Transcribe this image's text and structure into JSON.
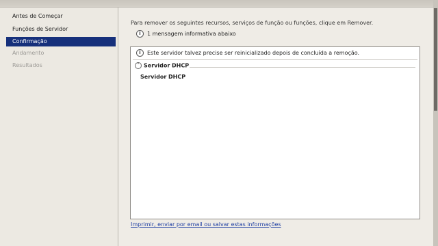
{
  "sidebar": {
    "items": [
      {
        "label": "Antes de Começar",
        "state": "normal"
      },
      {
        "label": "Funções de Servidor",
        "state": "normal"
      },
      {
        "label": "Confirmação",
        "state": "active"
      },
      {
        "label": "Andamento",
        "state": "disabled"
      },
      {
        "label": "Resultados",
        "state": "disabled"
      }
    ]
  },
  "main": {
    "instruction": "Para remover os seguintes recursos, serviços de função ou funções, clique em Remover.",
    "message_bar": "1 mensagem informativa abaixo",
    "info_icon_glyph": "i",
    "content": {
      "warning": "Este servidor talvez precise ser reinicializado depois de concluída a remoção.",
      "section_title": "Servidor DHCP",
      "collapse_glyph": "˄",
      "section_item": "Servidor DHCP"
    },
    "print_link": "Imprimir, enviar por email ou salvar estas informações"
  },
  "colors": {
    "active_nav": "#16307b",
    "link": "#1f3fa3"
  }
}
